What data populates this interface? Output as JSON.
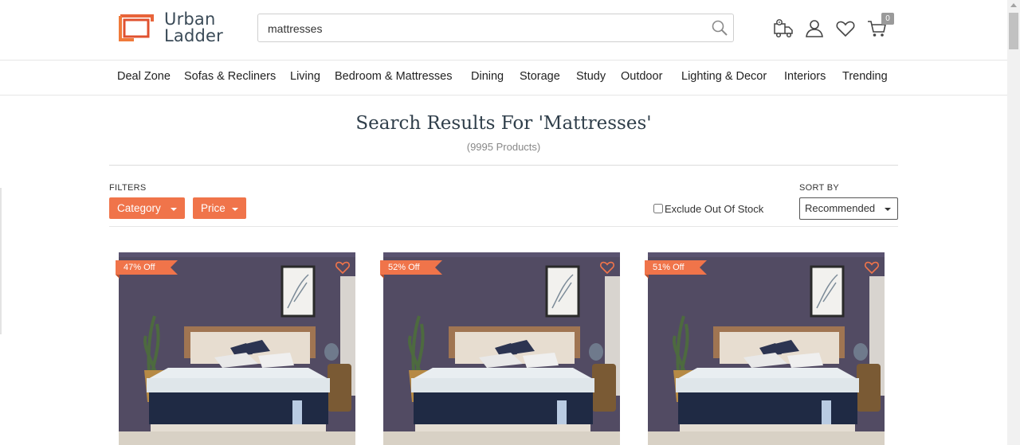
{
  "header": {
    "logo_line1": "Urban",
    "logo_line2": "Ladder",
    "search_value": "mattresses",
    "search_icon": "search-icon",
    "icons": [
      "delivery-truck-icon",
      "user-icon",
      "heart-icon",
      "cart-icon"
    ],
    "cart_count": "0"
  },
  "nav": {
    "items": [
      "Deal Zone",
      "Sofas & Recliners",
      "Living",
      "Bedroom & Mattresses",
      "Dining",
      "Storage",
      "Study",
      "Outdoor",
      "Lighting & Decor",
      "Interiors",
      "Trending"
    ]
  },
  "results": {
    "title": "Search Results For 'Mattresses'",
    "count": "(9995 Products)"
  },
  "filters": {
    "label": "FILTERS",
    "category": "Category",
    "price": "Price",
    "exclude_label": "Exclude Out Of Stock",
    "exclude_checked": false,
    "sort_label": "SORT BY",
    "sort_value": "Recommended"
  },
  "products": [
    {
      "discount": "47% Off"
    },
    {
      "discount": "52% Off"
    },
    {
      "discount": "51% Off"
    }
  ],
  "colors": {
    "accent": "#f0744a",
    "brand_text": "#3a4a57",
    "wall": "#524b63"
  }
}
